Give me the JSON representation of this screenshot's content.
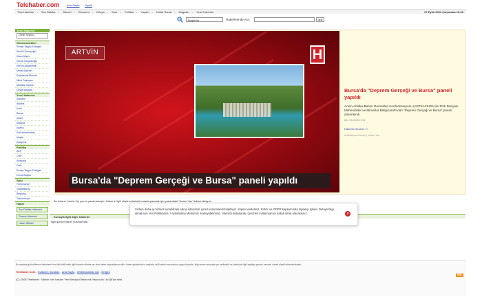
{
  "header": {
    "logo": "Telehaber.com",
    "top_links": [
      "Ana Sayfa",
      "Üyelik"
    ],
    "nav": [
      "Tüm Haberler",
      "Son Dakika",
      "Güncel",
      "Ekonomi",
      "Dünya",
      "Spor",
      "Politika",
      "Yaşam",
      "Kültür Sanat",
      "Magazin",
      "Yerel Haberler"
    ],
    "date": "27 Eylül 2023 Çarşamba 15:36"
  },
  "search": {
    "select_value": "Bugünün",
    "label": "Haberlerinde Ara:",
    "button": "ara"
  },
  "sidebar": {
    "head": "Yerel Haberler",
    "select_value": "--Şehir Seçiniz--",
    "section1": "Gündemdekiler",
    "people": [
      "Recep Tayyip Erdoğan",
      "Mevlüt Çavuşoğlu",
      "İlham Aliyev",
      "Kemal Kılıçdaroğlu",
      "Kerem Altıparmak",
      "Meral Akşener",
      "Emmanuel Macron",
      "Nikol Paşinyan",
      "Mustafa Varank",
      "Devlet Bahçeli"
    ],
    "section2": "Yerel Haberler",
    "cities": [
      "İstanbul",
      "Ankara",
      "İzmir",
      "Bursa",
      "Aydın",
      "Antalya",
      "Adana",
      "Kahramanmaraş",
      "Muğla",
      "Eskişehir"
    ],
    "section3": "Politika",
    "politics": [
      "AKP",
      "CHP",
      "Anayasa",
      "DHP",
      "Recep Tayyip Erdoğan",
      "Deniz Baykal"
    ],
    "section4": "Spor",
    "sports": [
      "Fenerbahçe",
      "Galatasaray",
      "Beşiktaş",
      "Trabzonspor"
    ],
    "section5": "Haber",
    "buttons": [
      "Son Dakika Haberleri",
      "Gazete Haberleri",
      "Haber Siteleri"
    ]
  },
  "feature": {
    "city_tag": "ARTVİN",
    "brand_letter": "H",
    "caption": "Bursa'da \"Deprem Gerçeği ve Bursa\" paneli yapıldı",
    "title": "Bursa'da \"Deprem Gerçeği ve Bursa\" paneli yapıldı",
    "summary": "Artvin-Ahiska-Batum Dernekleri Konfederasyonu (ARTKAFKON) ile Türk Dünyası Mühendisler ve Mimarlar Birliği tarafından \"Deprem Gerçeği ve Bursa\" paneli düzenlendi.",
    "meta": "AA, 3.5.2023 15:11",
    "more": "Haberin Devamı »»",
    "share": "Arkadaşına Gönder | Yorum Yaz"
  },
  "section_note": "Bu habere henüz hiç yorum yazılmamıştır. Haberle ilgili düşüncelerinizi burada yazmak için yukarıdaki 'Yorum Yaz' linkine tıklayın.",
  "cookie_popup": {
    "text": "Sizlere daha iyi hizmet sunabilmek adına sitemizde çerez konumlandırmaktayız. Kişisel verileriniz, KVKK ve GDPR kapsamında toplanıp işlenir. Detaylı bilgi almak için Veri Politikamızı / Aydınlatma Metnimizi inceleyebilirsiniz. Sitemizi kullanarak, çerezleri kullanmamızı kabul etmiş olacaksınız.",
    "close": "x"
  },
  "other_news": {
    "head": "Konuyla ilgili diğer haberler",
    "none": "İlgili güncel haber bulunamadı."
  },
  "footer": {
    "disclaimer": "Bu sayfada görüntülenen haberlerin her türlü telif hakkı ilgili haberin altında yer alan haber kaynaklarına aittir. Haber girişlerine bu sayfada, telif haberi mevzuatına uygun biçimde, bilgi verme amacıyla yer verilmiştir ve sitemizde ilgili sayfaya gerçek zamanlı olarak sürekli aktarılmaktadır.",
    "links": [
      "Telehaber.Com",
      "Kullanım Kuralları",
      "Ana Sayfa",
      "Webmasterlar için",
      "İletişim"
    ],
    "copyright": "(C) 2006 Telehaber. Sitenin tüm hakları Yeni Medya Elektronik Yayıncılık Ltd.Şti'ye aittir.",
    "xml": "XML"
  }
}
